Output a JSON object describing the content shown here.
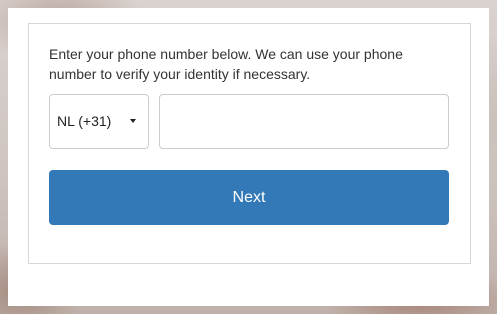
{
  "form": {
    "intro_text": "Enter your phone number below. We can use your phone number to verify your identity if necessary.",
    "country_code": {
      "selected": "NL (+31)",
      "icon": "caret-down-icon"
    },
    "phone_number": {
      "value": "",
      "placeholder": ""
    },
    "next_label": "Next"
  },
  "colors": {
    "button_bg": "#3479b7",
    "button_text": "#ffffff",
    "border": "#cccccc"
  }
}
